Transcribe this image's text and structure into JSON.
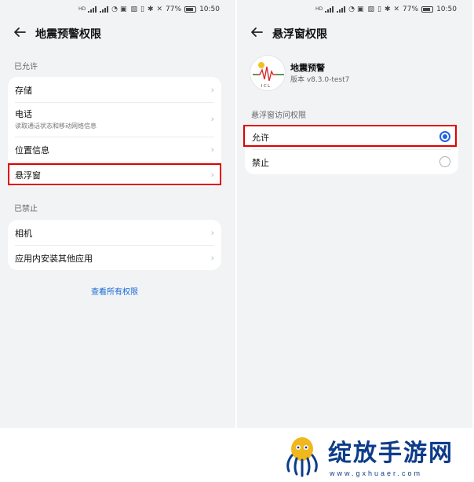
{
  "status": {
    "hd1": "HD",
    "hd2": "HD",
    "battery": "77%",
    "time": "10:50"
  },
  "left": {
    "title": "地震预警权限",
    "allowed_label": "已允许",
    "allowed_items": [
      {
        "label": "存储"
      },
      {
        "label": "电话",
        "sub": "读取通话状态和移动网络信息"
      },
      {
        "label": "位置信息"
      },
      {
        "label": "悬浮窗"
      }
    ],
    "forbidden_label": "已禁止",
    "forbidden_items": [
      {
        "label": "相机"
      },
      {
        "label": "应用内安装其他应用"
      }
    ],
    "view_all": "查看所有权限"
  },
  "right": {
    "title": "悬浮窗权限",
    "app_name": "地震预警",
    "app_version": "版本 v8.3.0-test7",
    "section_label": "悬浮窗访问权限",
    "options": [
      {
        "label": "允许",
        "selected": true
      },
      {
        "label": "禁止",
        "selected": false
      }
    ]
  },
  "icons": {
    "back": "back-arrow-icon",
    "chevron": "chevron-right-icon",
    "app": "earthquake-wave-icon",
    "chevron_glyph": "›"
  },
  "colors": {
    "accent": "#1e63e4",
    "highlight": "#e00000",
    "link": "#1769d4"
  },
  "watermark": {
    "text": "绽放手游网",
    "url": "www.gxhuaer.com"
  }
}
